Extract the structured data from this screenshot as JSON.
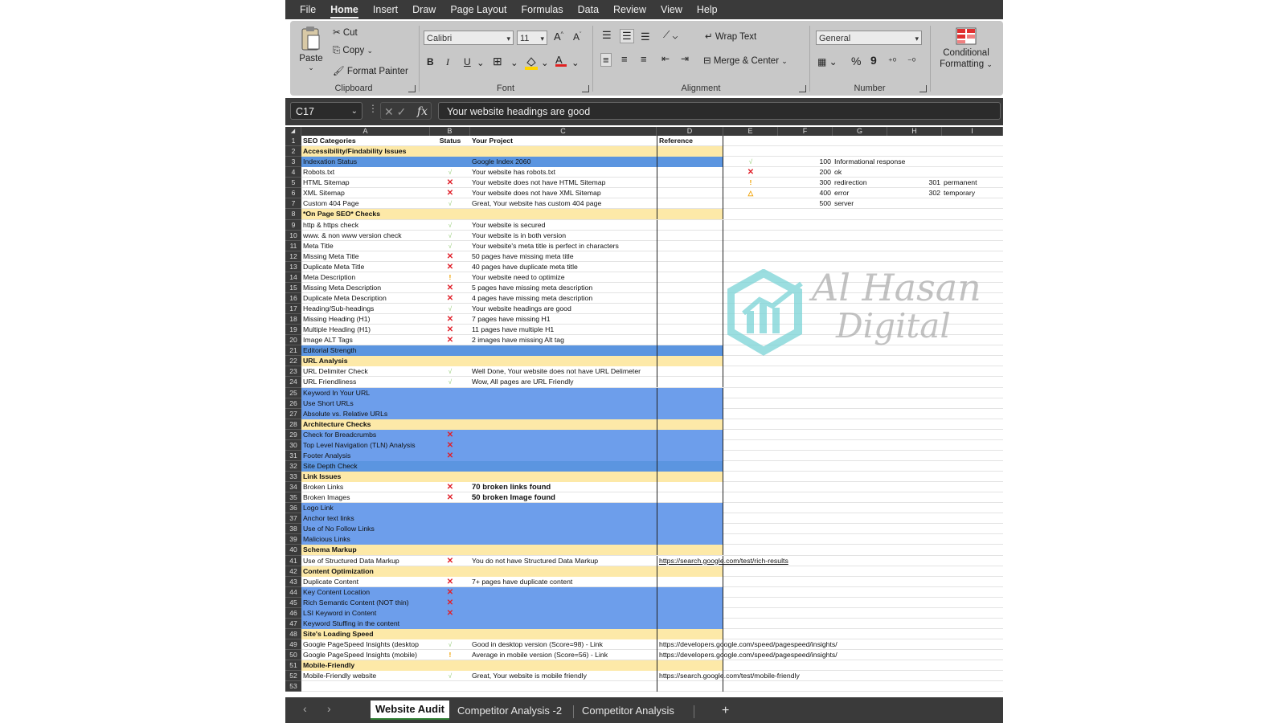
{
  "menu": [
    "File",
    "Home",
    "Insert",
    "Draw",
    "Page Layout",
    "Formulas",
    "Data",
    "Review",
    "View",
    "Help"
  ],
  "active_menu": "Home",
  "ribbon": {
    "clipboard": {
      "label": "Clipboard",
      "paste": "Paste",
      "cut": "Cut",
      "copy": "Copy",
      "format_painter": "Format Painter"
    },
    "font": {
      "label": "Font",
      "name": "Calibri",
      "size": "11",
      "bold": "B",
      "italic": "I",
      "underline": "U"
    },
    "alignment": {
      "label": "Alignment",
      "wrap_text": "Wrap Text",
      "merge_center": "Merge & Center"
    },
    "number": {
      "label": "Number",
      "format": "General",
      "percent": "%",
      "comma": "9"
    },
    "styles": {
      "conditional_line1": "Conditional",
      "conditional_line2": "Formatting"
    }
  },
  "formula_bar": {
    "cell_ref": "C17",
    "fx": "fx",
    "content": "Your website headings are good"
  },
  "columns": [
    "A",
    "B",
    "C",
    "D",
    "E",
    "F",
    "G",
    "H",
    "I"
  ],
  "rows": [
    {
      "n": "1",
      "type": "header",
      "a": "SEO Categories",
      "b": "Status",
      "c": "Your Project",
      "d": "Reference"
    },
    {
      "n": "2",
      "type": "section",
      "a": "Accessibility/Findability Issues"
    },
    {
      "n": "3",
      "type": "blueh",
      "a": "Indexation Status",
      "c": "Google Index 2060",
      "e": "√",
      "e_type": "check",
      "f": "100",
      "g": "Informational response"
    },
    {
      "n": "4",
      "a": "Robots.txt",
      "b": "√",
      "b_type": "check",
      "c": "Your website has robots.txt",
      "e": "✕",
      "e_type": "cross",
      "f": "200",
      "g": "ok"
    },
    {
      "n": "5",
      "a": "HTML Sitemap",
      "b": "✕",
      "b_type": "cross",
      "c": "Your website does not have HTML Sitemap",
      "e": "!",
      "e_type": "warn",
      "f": "300",
      "g": "redirection",
      "h": "301",
      "i": "permanent"
    },
    {
      "n": "6",
      "a": "XML Sitemap",
      "b": "✕",
      "b_type": "cross",
      "c": "Your website does not have  XML Sitemap",
      "e": "△",
      "e_type": "warn",
      "f": "400",
      "g": "error",
      "h": "302",
      "i": "temporary"
    },
    {
      "n": "7",
      "a": "Custom 404 Page",
      "b": "√",
      "b_type": "check",
      "c": "Great, Your website has custom 404 page",
      "f": "500",
      "g": "server"
    },
    {
      "n": "8",
      "type": "section",
      "a": "*On Page  SEO* Checks"
    },
    {
      "n": "9",
      "a": "http & https check",
      "b": "√",
      "b_type": "check",
      "c": "Your website is  secured"
    },
    {
      "n": "10",
      "a": "www. & non www version check",
      "b": "√",
      "b_type": "check",
      "c": "Your website is in both version"
    },
    {
      "n": "11",
      "a": "Meta Title",
      "b": "√",
      "b_type": "check",
      "c": "Your website's meta title is perfect in characters"
    },
    {
      "n": "12",
      "a": "Missing Meta Title",
      "b": "✕",
      "b_type": "cross",
      "c": "50 pages have missing meta title"
    },
    {
      "n": "13",
      "a": "Duplicate Meta Title",
      "b": "✕",
      "b_type": "cross",
      "c": "40 pages have duplicate meta title"
    },
    {
      "n": "14",
      "a": "Meta Description",
      "b": "!",
      "b_type": "warn",
      "c": "Your website need to optimize"
    },
    {
      "n": "15",
      "a": "Missing Meta Description",
      "b": "✕",
      "b_type": "cross",
      "c": "5 pages have missing meta description"
    },
    {
      "n": "16",
      "a": "Duplicate Meta Description",
      "b": "✕",
      "b_type": "cross",
      "c": "4 pages have missing meta description"
    },
    {
      "n": "17",
      "a": "Heading/Sub-headings",
      "b": "√",
      "b_type": "check",
      "c": "Your website headings are good"
    },
    {
      "n": "18",
      "a": "Missing Heading (H1)",
      "b": "✕",
      "b_type": "cross",
      "c": "7 pages have missing H1"
    },
    {
      "n": "19",
      "a": "Multiple Heading (H1)",
      "b": "✕",
      "b_type": "cross",
      "c": "11 pages have multiple H1"
    },
    {
      "n": "20",
      "a": "Image ALT Tags",
      "b": "✕",
      "b_type": "cross",
      "c": "2 images have missing Alt tag"
    },
    {
      "n": "21",
      "type": "blueh",
      "a": "Editorial Strength"
    },
    {
      "n": "22",
      "type": "section",
      "a": "URL Analysis"
    },
    {
      "n": "23",
      "a": "URL Delimiter Check",
      "b": "√",
      "b_type": "check",
      "c": "Well Done, Your website does not have URL Delimeter"
    },
    {
      "n": "24",
      "a": "URL Friendliness",
      "b": "√",
      "b_type": "check",
      "c": "Wow, All pages are URL Friendly"
    },
    {
      "n": "25",
      "type": "blue",
      "a": "Keyword In Your URL"
    },
    {
      "n": "26",
      "type": "blue",
      "a": "Use Short URLs"
    },
    {
      "n": "27",
      "type": "blue",
      "a": "Absolute vs. Relative URLs"
    },
    {
      "n": "28",
      "type": "section",
      "a": "Architecture Checks"
    },
    {
      "n": "29",
      "type": "blue",
      "a": "Check for Breadcrumbs",
      "b": "✕",
      "b_type": "cross"
    },
    {
      "n": "30",
      "type": "blue",
      "a": "Top Level Navigation (TLN) Analysis",
      "b": "✕",
      "b_type": "cross"
    },
    {
      "n": "31",
      "type": "blue",
      "a": "Footer Analysis",
      "b": "✕",
      "b_type": "cross"
    },
    {
      "n": "32",
      "type": "blueh",
      "a": "Site Depth Check"
    },
    {
      "n": "33",
      "type": "section",
      "a": "Link Issues"
    },
    {
      "n": "34",
      "a": "Broken Links",
      "b": "✕",
      "b_type": "cross",
      "c": "70 broken links found",
      "c_bold": true
    },
    {
      "n": "35",
      "a": "Broken Images",
      "b": "✕",
      "b_type": "cross",
      "c": "50 broken Image found",
      "c_bold": true
    },
    {
      "n": "36",
      "type": "blue",
      "a": "Logo Link"
    },
    {
      "n": "37",
      "type": "blue",
      "a": "Anchor text links"
    },
    {
      "n": "38",
      "type": "blue",
      "a": "Use of No Follow Links"
    },
    {
      "n": "39",
      "type": "blue",
      "a": "Malicious Links"
    },
    {
      "n": "40",
      "type": "section",
      "a": "Schema Markup"
    },
    {
      "n": "41",
      "a": "Use of Structured Data Markup",
      "b": "✕",
      "b_type": "cross",
      "c": "You do not have Structured Data Markup",
      "d": "https://search.google.com/test/rich-results",
      "d_link": true
    },
    {
      "n": "42",
      "type": "section",
      "a": "Content Optimization"
    },
    {
      "n": "43",
      "a": "Duplicate Content",
      "b": "✕",
      "b_type": "cross",
      "c": "7+ pages have duplicate content"
    },
    {
      "n": "44",
      "type": "blue",
      "a": "Key Content Location",
      "b": "✕",
      "b_type": "cross"
    },
    {
      "n": "45",
      "type": "blue",
      "a": "Rich Semantic Content (NOT thin)",
      "b": "✕",
      "b_type": "cross"
    },
    {
      "n": "46",
      "type": "blue",
      "a": "LSI Keyword in Content",
      "b": "✕",
      "b_type": "cross"
    },
    {
      "n": "47",
      "type": "blue",
      "a": "Keyword Stuffing in the content"
    },
    {
      "n": "48",
      "type": "section",
      "a": "Site's Loading Speed"
    },
    {
      "n": "49",
      "a": "Google PageSpeed Insights (desktop",
      "b": "√",
      "b_type": "check",
      "c": "Good in desktop version (Score=98) - Link",
      "d": "https://developers.google.com/speed/pagespeed/insights/"
    },
    {
      "n": "50",
      "a": "Google PageSpeed Insights (mobile)",
      "b": "!",
      "b_type": "warn",
      "c": "Average in mobile version (Score=56) - Link",
      "d": "https://developers.google.com/speed/pagespeed/insights/"
    },
    {
      "n": "51",
      "type": "section",
      "a": "Mobile-Friendly"
    },
    {
      "n": "52",
      "a": "Mobile-Friendly website",
      "b": "√",
      "b_type": "check",
      "c": "Great, Your website is mobile friendly",
      "d": "https://search.google.com/test/mobile-friendly"
    },
    {
      "n": "53"
    }
  ],
  "watermark": {
    "line1": "Al Hasan",
    "line2": "Digital",
    "logo_color": "#7ad3d6"
  },
  "sheet_tabs": [
    "Website Audit",
    "Competitor Analysis -2",
    "Competitor Analysis"
  ],
  "active_tab": "Website Audit",
  "add_sheet": "+",
  "colors": {
    "section": "#fde9a8",
    "blue": "#6d9eeb",
    "cross": "#e0202a",
    "check": "#8fc86f",
    "warn": "#f0a000"
  }
}
